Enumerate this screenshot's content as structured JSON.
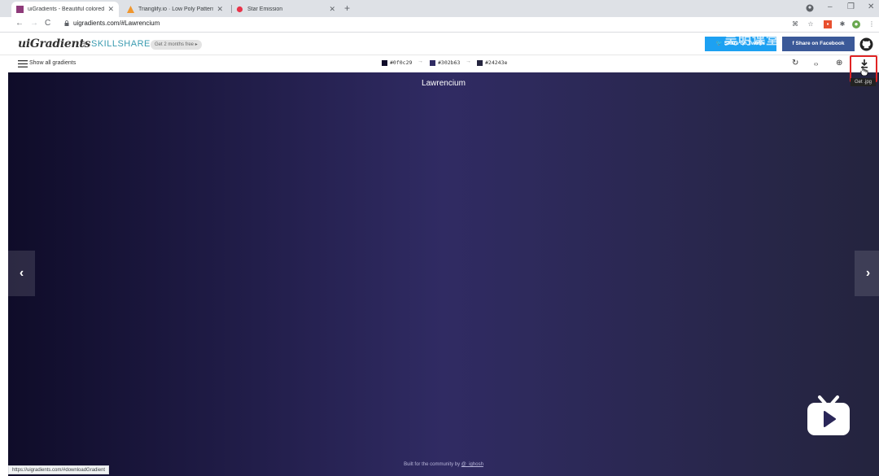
{
  "browser": {
    "tabs": [
      {
        "title": "uiGradients - Beautiful colored",
        "active": true,
        "favicon_color": "#8e3a7a"
      },
      {
        "title": "Trianglify.io · Low Poly Pattern",
        "active": false,
        "favicon_color": "#f0962d"
      },
      {
        "title": "Star Emission",
        "active": false,
        "favicon_color": "#e8344a"
      }
    ],
    "new_tab_label": "+",
    "url": "uigradients.com/#Lawrencium",
    "status_url": "https://uigradients.com/#downloadGradient"
  },
  "site": {
    "logo": "uiGradients",
    "plus": "+",
    "partner": "SKILLSHARE",
    "promo": "Get 2 months free ▸",
    "twitter_label": "Share on Twitter",
    "facebook_label": "Share on Facebook",
    "watermark": "吴明课堂"
  },
  "toolbar": {
    "show_all_label": "Show all gradients",
    "colors": [
      {
        "hex": "#0f0c29",
        "label": "#0f0c29"
      },
      {
        "hex": "#302b63",
        "label": "#302b63"
      },
      {
        "hex": "#24243e",
        "label": "#24243e"
      }
    ],
    "arrow_glyph": "→",
    "tooltip": "Get .jpg"
  },
  "gradient": {
    "name": "Lawrencium",
    "colors": [
      "#0f0c29",
      "#302b63",
      "#24243e"
    ],
    "prev_glyph": "‹",
    "next_glyph": "›",
    "footer_text": "Built for the community by",
    "footer_link": "@_ighosh"
  },
  "colors": {
    "highlight": "#e02424",
    "twitter": "#1da1f2",
    "facebook": "#3b5998",
    "skillshare": "#3a9bb0"
  }
}
